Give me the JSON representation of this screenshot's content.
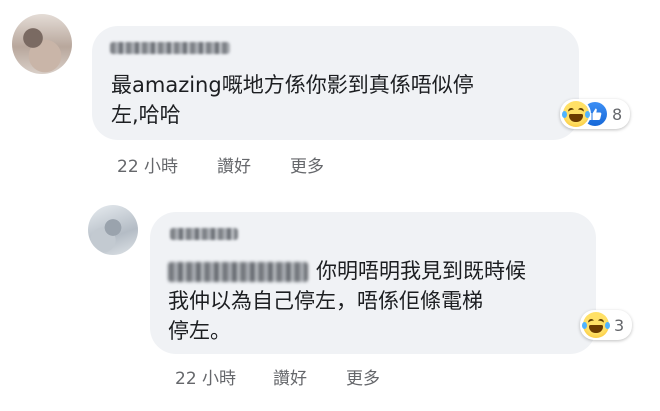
{
  "comments": [
    {
      "text_line1": "最amazing嘅地方係你影到真係唔似停",
      "text_line2": "左,哈哈",
      "reaction_count": "8",
      "time": "22 小時",
      "like_label": "讚好",
      "more_label": "更多"
    },
    {
      "text_line1": "你明唔明我見到既時候",
      "text_line2": "我仲以為自己停左，唔係佢條電梯",
      "text_line3": "停左。",
      "reaction_count": "3",
      "time": "22 小時",
      "like_label": "讚好",
      "more_label": "更多"
    }
  ],
  "colors": {
    "bubble": "#f0f2f5",
    "meta_text": "#65676b",
    "like_blue": "#1877f2"
  },
  "icons": [
    "haha-reaction-icon",
    "like-reaction-icon"
  ]
}
